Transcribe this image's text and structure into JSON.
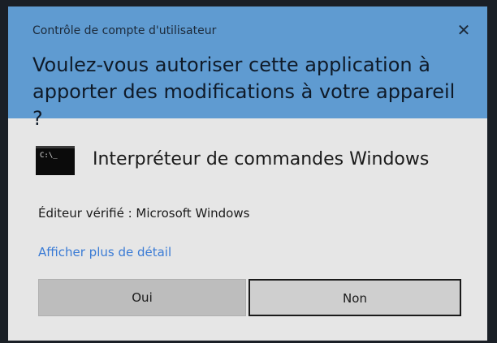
{
  "window": {
    "caption": "Contrôle de compte d'utilisateur",
    "close_glyph": "✕",
    "question": "Voulez-vous autoriser cette application à apporter des modifications à votre appareil ?"
  },
  "app": {
    "icon": "command-prompt-icon",
    "icon_prompt_text": "C:\\_",
    "name": "Interpréteur de commandes Windows"
  },
  "publisher": {
    "text": "Éditeur vérifié : Microsoft Windows"
  },
  "details_link": {
    "text": "Afficher plus de détail"
  },
  "buttons": {
    "yes_label": "Oui",
    "no_label": "Non"
  },
  "colors": {
    "header_blue": "#5f9bd1",
    "body_gray": "#e6e6e6",
    "link_blue": "#3a7bd5"
  }
}
